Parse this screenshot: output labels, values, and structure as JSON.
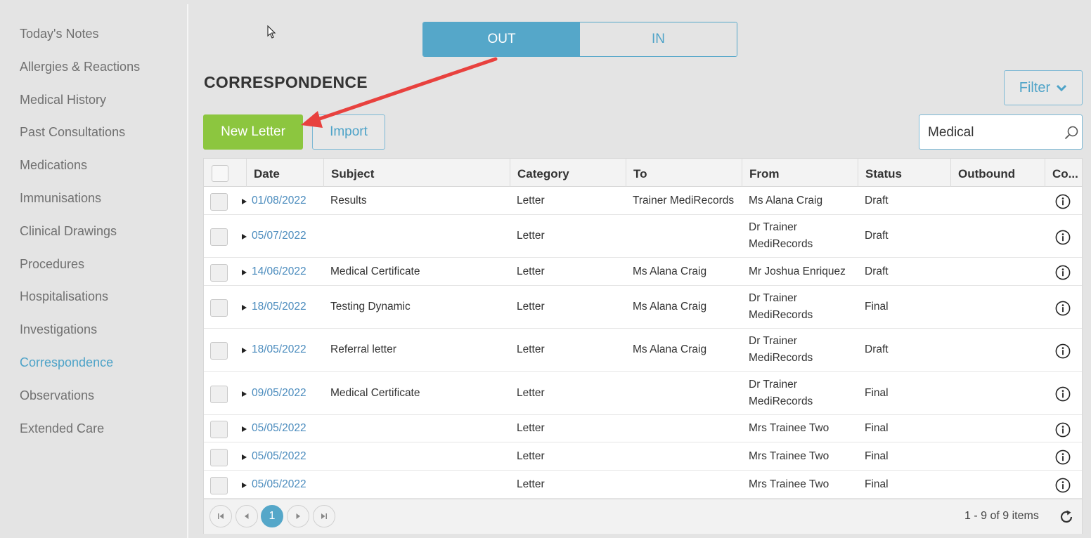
{
  "sidebar": {
    "items": [
      {
        "label": "Today's Notes"
      },
      {
        "label": "Allergies & Reactions"
      },
      {
        "label": "Medical History"
      },
      {
        "label": "Past Consultations"
      },
      {
        "label": "Medications"
      },
      {
        "label": "Immunisations"
      },
      {
        "label": "Clinical Drawings"
      },
      {
        "label": "Procedures"
      },
      {
        "label": "Hospitalisations"
      },
      {
        "label": "Investigations"
      },
      {
        "label": "Correspondence",
        "active": true
      },
      {
        "label": "Observations"
      },
      {
        "label": "Extended Care"
      }
    ]
  },
  "toggle": {
    "out_label": "OUT",
    "in_label": "IN",
    "selected": "OUT"
  },
  "page": {
    "title": "CORRESPONDENCE"
  },
  "toolbar": {
    "filter_label": "Filter",
    "new_letter_label": "New Letter",
    "import_label": "Import"
  },
  "search": {
    "value": "Medical"
  },
  "table": {
    "columns": {
      "date": "Date",
      "subject": "Subject",
      "category": "Category",
      "to": "To",
      "from": "From",
      "status": "Status",
      "outbound": "Outbound",
      "comments": "Co..."
    },
    "rows": [
      {
        "date": "01/08/2022",
        "subject": "Results",
        "category": "Letter",
        "to": "Trainer MediRecords",
        "from": "Ms Alana Craig",
        "status": "Draft",
        "outbound": ""
      },
      {
        "date": "05/07/2022",
        "subject": "",
        "category": "Letter",
        "to": "",
        "from": "Dr Trainer MediRecords",
        "status": "Draft",
        "outbound": ""
      },
      {
        "date": "14/06/2022",
        "subject": "Medical Certificate",
        "category": "Letter",
        "to": "Ms Alana Craig",
        "from": "Mr Joshua Enriquez",
        "status": "Draft",
        "outbound": ""
      },
      {
        "date": "18/05/2022",
        "subject": "Testing Dynamic",
        "category": "Letter",
        "to": "Ms Alana Craig",
        "from": "Dr Trainer MediRecords",
        "status": "Final",
        "outbound": ""
      },
      {
        "date": "18/05/2022",
        "subject": "Referral letter",
        "category": "Letter",
        "to": "Ms Alana Craig",
        "from": "Dr Trainer MediRecords",
        "status": "Draft",
        "outbound": ""
      },
      {
        "date": "09/05/2022",
        "subject": "Medical Certificate",
        "category": "Letter",
        "to": "",
        "from": "Dr Trainer MediRecords",
        "status": "Final",
        "outbound": ""
      },
      {
        "date": "05/05/2022",
        "subject": "",
        "category": "Letter",
        "to": "",
        "from": "Mrs Trainee Two",
        "status": "Final",
        "outbound": ""
      },
      {
        "date": "05/05/2022",
        "subject": "",
        "category": "Letter",
        "to": "",
        "from": "Mrs Trainee Two",
        "status": "Final",
        "outbound": ""
      },
      {
        "date": "05/05/2022",
        "subject": "",
        "category": "Letter",
        "to": "",
        "from": "Mrs Trainee Two",
        "status": "Final",
        "outbound": ""
      }
    ]
  },
  "pager": {
    "current_page": "1",
    "info": "1 - 9 of 9 items"
  },
  "colors": {
    "accent": "#55a7c9",
    "link": "#4a8bbd",
    "primary_button": "#8cc63f",
    "annotation_arrow": "#e8413e"
  }
}
